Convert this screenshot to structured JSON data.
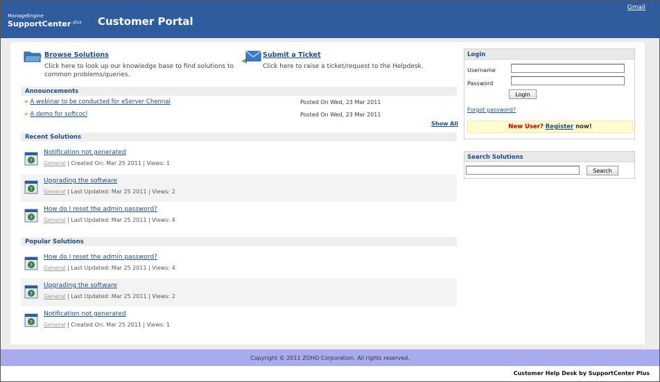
{
  "header": {
    "logo_top": "ManageEngine",
    "logo_main": "SupportCenter",
    "logo_sup": "plus",
    "title": "Customer Portal",
    "gmail_link": "Gmail"
  },
  "quick_links": {
    "browse": {
      "title": "Browse Solutions",
      "desc_line1": "Click here to look up our knowledge base to find solutions to",
      "desc_line2": "common problems/queries."
    },
    "ticket": {
      "title": "Submit a Ticket",
      "desc": "Click here to raise a ticket/request to the Helpdesk."
    }
  },
  "announcements": {
    "heading": "Announcements",
    "bullet": "»",
    "items": [
      {
        "title": "A webinar to be conducted for eServer Chennai",
        "date": "Posted On Wed, 23 Mar 2011"
      },
      {
        "title": "A demo for softcocl",
        "date": "Posted On Wed, 23 Mar 2011"
      }
    ],
    "show_all": "Show All"
  },
  "recent_solutions": {
    "heading": "Recent Solutions",
    "items": [
      {
        "title": "Notification not generated",
        "category": "General",
        "meta": " | Created On: Mar 25 2011 | Views: 1"
      },
      {
        "title": "Upgrading the software",
        "category": "General",
        "meta": " | Last Updated: Mar 25 2011 | Views: 2"
      },
      {
        "title": "How do I reset the admin password?",
        "category": "General",
        "meta": " | Last Updated: Mar 25 2011 | Views: 4"
      }
    ]
  },
  "popular_solutions": {
    "heading": "Popular Solutions",
    "items": [
      {
        "title": "How do I reset the admin password?",
        "category": "General",
        "meta": " | Last Updated: Mar 25 2011 | Views: 4"
      },
      {
        "title": "Upgrading the software",
        "category": "General",
        "meta": " | Last Updated: Mar 25 2011 | Views: 2"
      },
      {
        "title": "Notification not generated",
        "category": "General",
        "meta": " | Created On: Mar 25 2011 | Views: 1"
      }
    ]
  },
  "login": {
    "heading": "Login",
    "username_label": "Username",
    "username_value": "",
    "password_label": "Password",
    "password_value": "",
    "login_button": "Login",
    "forgot_link": "Forgot password?",
    "new_user_q": "New User?",
    "register_link": "Register",
    "new_user_tail": "now!"
  },
  "search": {
    "heading": "Search Solutions",
    "input_value": "",
    "button": "Search"
  },
  "footer": {
    "copyright": "Copyright © 2011 ZOHO Corporation. All rights reserved.",
    "credit": "Customer Help Desk by SupportCenter Plus"
  },
  "colors": {
    "header_bg": "#2f5c9e",
    "footer_bg": "#a9abef",
    "link": "#1a4e8a",
    "new_user_bg": "#fffccf"
  }
}
